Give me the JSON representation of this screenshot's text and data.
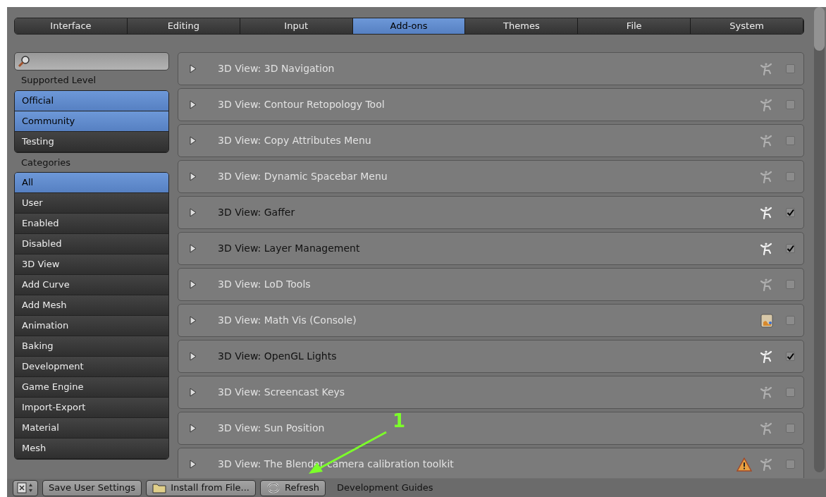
{
  "tabs": [
    {
      "label": "Interface",
      "selected": false
    },
    {
      "label": "Editing",
      "selected": false
    },
    {
      "label": "Input",
      "selected": false
    },
    {
      "label": "Add-ons",
      "selected": true
    },
    {
      "label": "Themes",
      "selected": false
    },
    {
      "label": "File",
      "selected": false
    },
    {
      "label": "System",
      "selected": false
    }
  ],
  "sidebar": {
    "supported_level": {
      "label": "Supported Level",
      "items": [
        {
          "label": "Official",
          "selected": true
        },
        {
          "label": "Community",
          "selected": true
        },
        {
          "label": "Testing",
          "selected": false
        }
      ]
    },
    "categories": {
      "label": "Categories",
      "items": [
        {
          "label": "All",
          "selected": true
        },
        {
          "label": "User",
          "selected": false
        },
        {
          "label": "Enabled",
          "selected": false
        },
        {
          "label": "Disabled",
          "selected": false
        },
        {
          "label": "3D View",
          "selected": false
        },
        {
          "label": "Add Curve",
          "selected": false
        },
        {
          "label": "Add Mesh",
          "selected": false
        },
        {
          "label": "Animation",
          "selected": false
        },
        {
          "label": "Baking",
          "selected": false
        },
        {
          "label": "Development",
          "selected": false
        },
        {
          "label": "Game Engine",
          "selected": false
        },
        {
          "label": "Import-Export",
          "selected": false
        },
        {
          "label": "Material",
          "selected": false
        },
        {
          "label": "Mesh",
          "selected": false
        }
      ]
    }
  },
  "addons": [
    {
      "name": "3D View: 3D Navigation",
      "kind": "community",
      "warning": false,
      "checked": false
    },
    {
      "name": "3D View: Contour Retopology Tool",
      "kind": "community",
      "warning": false,
      "checked": false
    },
    {
      "name": "3D View: Copy Attributes Menu",
      "kind": "community",
      "warning": false,
      "checked": false
    },
    {
      "name": "3D View: Dynamic Spacebar Menu",
      "kind": "community",
      "warning": false,
      "checked": false
    },
    {
      "name": "3D View: Gaffer",
      "kind": "community",
      "warning": false,
      "checked": true
    },
    {
      "name": "3D View: Layer Management",
      "kind": "community",
      "warning": false,
      "checked": true
    },
    {
      "name": "3D View: LoD Tools",
      "kind": "community",
      "warning": false,
      "checked": false
    },
    {
      "name": "3D View: Math Vis (Console)",
      "kind": "official",
      "warning": false,
      "checked": false
    },
    {
      "name": "3D View: OpenGL Lights",
      "kind": "community",
      "warning": false,
      "checked": true
    },
    {
      "name": "3D View: Screencast Keys",
      "kind": "community",
      "warning": false,
      "checked": false
    },
    {
      "name": "3D View: Sun Position",
      "kind": "community",
      "warning": false,
      "checked": false
    },
    {
      "name": "3D View: The Blender camera calibration toolkit",
      "kind": "community",
      "warning": true,
      "checked": false
    }
  ],
  "bottom_bar": {
    "buttons": [
      {
        "label": "Save User Settings",
        "kind": "plain"
      },
      {
        "label": "Install from File...",
        "kind": "folder"
      },
      {
        "label": "Refresh",
        "kind": "refresh"
      }
    ],
    "link": "Development Guides"
  },
  "annotation": {
    "label": "1"
  }
}
